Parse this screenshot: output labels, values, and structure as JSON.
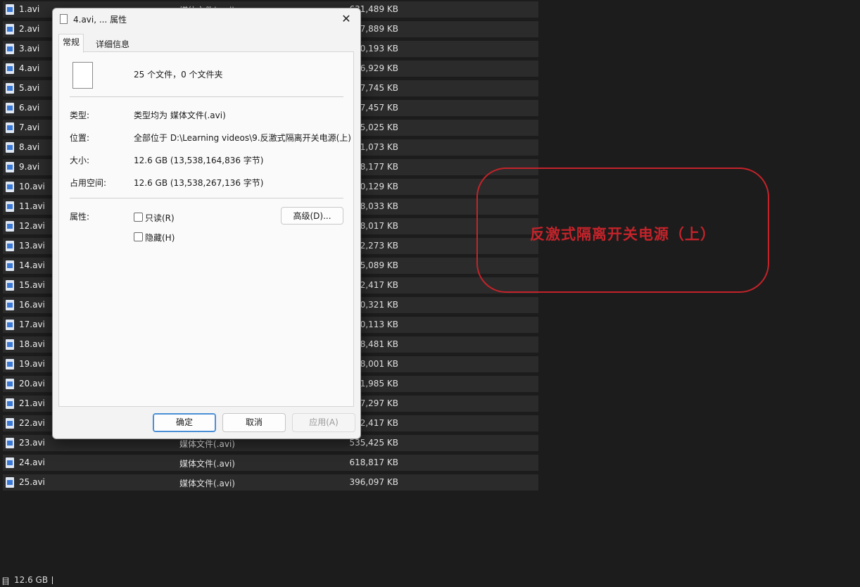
{
  "files": [
    {
      "name": "1.avi",
      "type": "媒体文件(.avi)",
      "size": "631,489 KB"
    },
    {
      "name": "2.avi",
      "type": "",
      "size": "597,889 KB"
    },
    {
      "name": "3.avi",
      "type": "",
      "size": "580,193 KB"
    },
    {
      "name": "4.avi",
      "type": "",
      "size": "596,929 KB"
    },
    {
      "name": "5.avi",
      "type": "",
      "size": "587,745 KB"
    },
    {
      "name": "6.avi",
      "type": "",
      "size": "507,457 KB"
    },
    {
      "name": "7.avi",
      "type": "",
      "size": "565,025 KB"
    },
    {
      "name": "8.avi",
      "type": "",
      "size": "511,073 KB"
    },
    {
      "name": "9.avi",
      "type": "",
      "size": "518,177 KB"
    },
    {
      "name": "10.avi",
      "type": "",
      "size": "560,129 KB"
    },
    {
      "name": "11.avi",
      "type": "",
      "size": "508,033 KB"
    },
    {
      "name": "12.avi",
      "type": "",
      "size": "538,017 KB"
    },
    {
      "name": "13.avi",
      "type": "",
      "size": "552,273 KB"
    },
    {
      "name": "14.avi",
      "type": "",
      "size": "545,089 KB"
    },
    {
      "name": "15.avi",
      "type": "",
      "size": "592,417 KB"
    },
    {
      "name": "16.avi",
      "type": "",
      "size": "500,321 KB"
    },
    {
      "name": "17.avi",
      "type": "",
      "size": "560,113 KB"
    },
    {
      "name": "18.avi",
      "type": "",
      "size": "548,481 KB"
    },
    {
      "name": "19.avi",
      "type": "",
      "size": "538,001 KB"
    },
    {
      "name": "20.avi",
      "type": "",
      "size": "541,985 KB"
    },
    {
      "name": "21.avi",
      "type": "",
      "size": "547,297 KB"
    },
    {
      "name": "22.avi",
      "type": "",
      "size": "592,417 KB"
    },
    {
      "name": "23.avi",
      "type": "媒体文件(.avi)",
      "size": "535,425 KB"
    },
    {
      "name": "24.avi",
      "type": "媒体文件(.avi)",
      "size": "618,817 KB"
    },
    {
      "name": "25.avi",
      "type": "媒体文件(.avi)",
      "size": "396,097 KB"
    }
  ],
  "status_bar": {
    "prefix": "目",
    "total": "12.6 GB"
  },
  "annotation": {
    "text": "反激式隔离开关电源（上）",
    "color": "#c4232a"
  },
  "dialog": {
    "title": "4.avi, ... 属性",
    "close_icon": "close-icon",
    "tabs": [
      "常规",
      "详细信息"
    ],
    "summary": "25 个文件，0 个文件夹",
    "rows": [
      {
        "label": "类型:",
        "value": "类型均为 媒体文件(.avi)"
      },
      {
        "label": "位置:",
        "value": "全部位于 D:\\Learning videos\\9.反激式隔离开关电源(上)"
      },
      {
        "label": "大小:",
        "value": "12.6 GB (13,538,164,836 字节)"
      },
      {
        "label": "占用空间:",
        "value": "12.6 GB (13,538,267,136 字节)"
      }
    ],
    "attributes_label": "属性:",
    "readonly_label": "只读(R)",
    "hidden_label": "隐藏(H)",
    "advanced_label": "高级(D)...",
    "ok_label": "确定",
    "cancel_label": "取消",
    "apply_label": "应用(A)"
  }
}
